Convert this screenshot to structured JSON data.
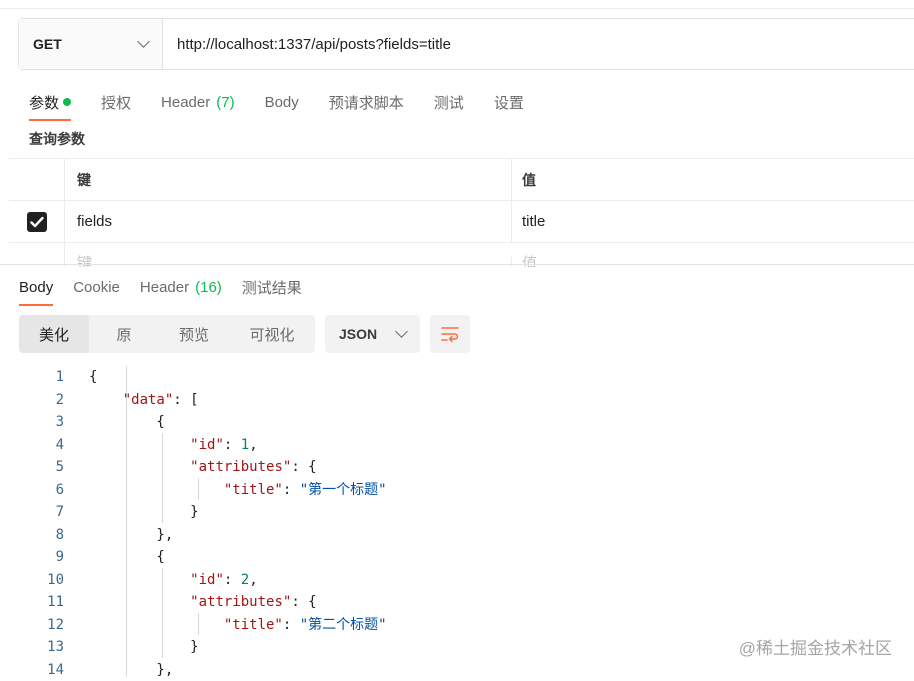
{
  "request": {
    "method": "GET",
    "url": "http://localhost:1337/api/posts?fields=title"
  },
  "request_tabs": [
    {
      "label": "参数",
      "active": true
    },
    {
      "label": "授权"
    },
    {
      "label": "Header",
      "count": "(7)"
    },
    {
      "label": "Body"
    },
    {
      "label": "预请求脚本"
    },
    {
      "label": "测试"
    },
    {
      "label": "设置"
    }
  ],
  "params": {
    "title": "查询参数",
    "header_key": "键",
    "header_value": "值",
    "rows": [
      {
        "checked": true,
        "key": "fields",
        "value": "title"
      }
    ],
    "placeholder_key": "键",
    "placeholder_value": "值"
  },
  "response_tabs": [
    {
      "label": "Body",
      "active": true
    },
    {
      "label": "Cookie"
    },
    {
      "label": "Header",
      "count": "(16)"
    },
    {
      "label": "测试结果"
    }
  ],
  "view_modes": [
    "美化",
    "原",
    "预览",
    "可视化"
  ],
  "active_view_mode": "美化",
  "format": "JSON",
  "code_lines": [
    {
      "num": "1",
      "text": "{"
    },
    {
      "num": "2",
      "text": "    \"data\": ["
    },
    {
      "num": "3",
      "text": "        {"
    },
    {
      "num": "4",
      "text": "            \"id\": 1,"
    },
    {
      "num": "5",
      "text": "            \"attributes\": {"
    },
    {
      "num": "6",
      "text": "                \"title\": \"第一个标题\""
    },
    {
      "num": "7",
      "text": "            }"
    },
    {
      "num": "8",
      "text": "        },"
    },
    {
      "num": "9",
      "text": "        {"
    },
    {
      "num": "10",
      "text": "            \"id\": 2,"
    },
    {
      "num": "11",
      "text": "            \"attributes\": {"
    },
    {
      "num": "12",
      "text": "                \"title\": \"第二个标题\""
    },
    {
      "num": "13",
      "text": "            }"
    },
    {
      "num": "14",
      "text": "        },"
    }
  ],
  "watermark": "@稀土掘金技术社区",
  "colors": {
    "accent": "#ff6c37",
    "success": "#0cbb52"
  },
  "icons": [
    "chevron-down-icon",
    "checkmark-icon",
    "wrap-lines-icon"
  ]
}
